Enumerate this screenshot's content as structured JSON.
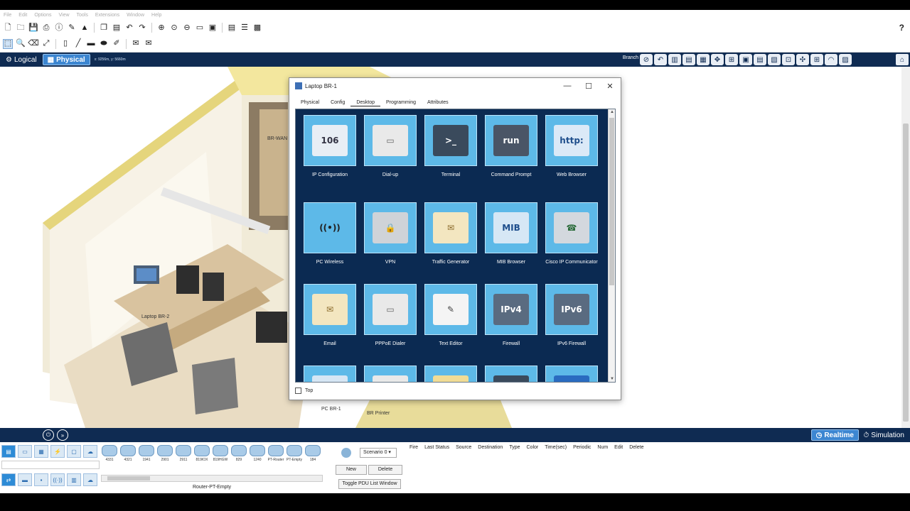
{
  "menu": [
    "File",
    "Edit",
    "Options",
    "View",
    "Tools",
    "Extensions",
    "Window",
    "Help"
  ],
  "help_label": "?",
  "workspace": {
    "logical_label": "Logical",
    "physical_label": "Physical",
    "coords": "x: 9256m, y: 5660m",
    "branch_label": "Branch"
  },
  "canvas_labels": {
    "wan_router": "BR-WAN",
    "laptop": "Laptop BR-2",
    "pc": "PC BR-1",
    "printer": "BR Printer"
  },
  "dialog": {
    "title": "Laptop BR-1",
    "minimize": "—",
    "maximize": "☐",
    "close": "✕",
    "tabs": [
      "Physical",
      "Config",
      "Desktop",
      "Programming",
      "Attributes"
    ],
    "active_tab": "Desktop",
    "top_checkbox_label": "Top",
    "apps": [
      {
        "label": "IP Configuration",
        "glyph": "106"
      },
      {
        "label": "Dial-up",
        "glyph": "▭"
      },
      {
        "label": "Terminal",
        "glyph": ">_"
      },
      {
        "label": "Command Prompt",
        "glyph": "run"
      },
      {
        "label": "Web Browser",
        "glyph": "http:"
      },
      {
        "label": "PC Wireless",
        "glyph": "((•))"
      },
      {
        "label": "VPN",
        "glyph": "🔒"
      },
      {
        "label": "Traffic Generator",
        "glyph": "✉"
      },
      {
        "label": "MIB Browser",
        "glyph": "MIB"
      },
      {
        "label": "Cisco IP Communicator",
        "glyph": "☎"
      },
      {
        "label": "Email",
        "glyph": "✉"
      },
      {
        "label": "PPPoE Dialer",
        "glyph": "▭"
      },
      {
        "label": "Text Editor",
        "glyph": "✎"
      },
      {
        "label": "Firewall",
        "glyph": "IPv4"
      },
      {
        "label": "IPv6 Firewall",
        "glyph": "IPv6"
      },
      {
        "label": "",
        "glyph": "◔"
      },
      {
        "label": "",
        "glyph": "▭"
      },
      {
        "label": "",
        "glyph": "📁"
      },
      {
        "label": "",
        "glyph": ">_"
      },
      {
        "label": "",
        "glyph": "➤"
      }
    ]
  },
  "timebar": {
    "realtime_label": "Realtime",
    "simulation_label": "Simulation"
  },
  "devices": {
    "models": [
      "4331",
      "4321",
      "1941",
      "2901",
      "2911",
      "819IOX",
      "819HGW",
      "829",
      "1240",
      "PT-Router",
      "PT-Empty",
      "184"
    ],
    "selected_name": "Router-PT-Empty"
  },
  "scenario": {
    "select_value": "Scenario 0",
    "new_label": "New",
    "delete_label": "Delete",
    "toggle_label": "Toggle PDU List Window"
  },
  "pdu_columns": [
    "Fire",
    "Last Status",
    "Source",
    "Destination",
    "Type",
    "Color",
    "Time(sec)",
    "Periodic",
    "Num",
    "Edit",
    "Delete"
  ],
  "colors": {
    "navy": "#0f2b52",
    "accent": "#3c86d1",
    "tile": "#5db9e8",
    "panel": "#0b2a52"
  }
}
